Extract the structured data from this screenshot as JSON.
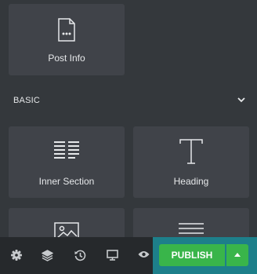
{
  "widgets_top": [
    {
      "label": "Post Info",
      "icon": "post-info-icon"
    }
  ],
  "basic_section": {
    "title": "BASIC",
    "toggle_icon": "chevron-down-icon",
    "widgets": [
      {
        "label": "Inner Section",
        "icon": "inner-section-icon"
      },
      {
        "label": "Heading",
        "icon": "heading-icon"
      },
      {
        "label": "",
        "icon": "image-icon"
      },
      {
        "label": "",
        "icon": "text-editor-icon"
      }
    ]
  },
  "footer": {
    "icons": [
      "settings-icon",
      "navigator-layers-icon",
      "history-icon",
      "responsive-mode-icon",
      "preview-eye-icon"
    ],
    "publish_label": "PUBLISH",
    "publish_options_icon": "caret-up-icon"
  },
  "colors": {
    "background": "#34383c",
    "tile": "#404349",
    "footer": "#26292c",
    "publish_green": "#39b54a",
    "publish_highlight": "#1d7f8a"
  }
}
